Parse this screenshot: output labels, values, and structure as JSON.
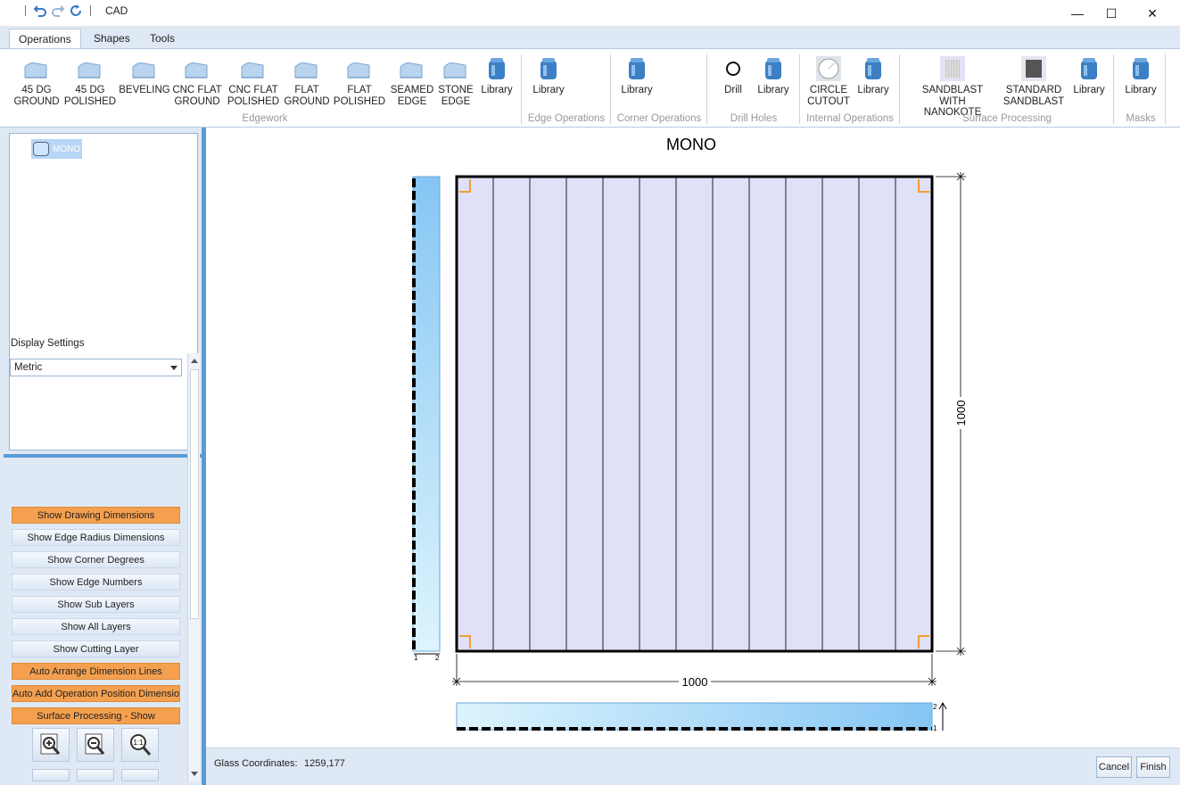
{
  "app": {
    "title": "CAD"
  },
  "window": {
    "minimize_glyph": "—",
    "maximize_glyph": "☐",
    "close_glyph": "✕"
  },
  "tabs": [
    {
      "label": "Operations",
      "active": true
    },
    {
      "label": "Shapes",
      "active": false
    },
    {
      "label": "Tools",
      "active": false
    }
  ],
  "ribbon": {
    "buttons": [
      {
        "label1": "45 DG",
        "label2": "GROUND",
        "icon": "edge-profile-icon"
      },
      {
        "label1": "45 DG",
        "label2": "POLISHED",
        "icon": "edge-profile-icon"
      },
      {
        "label1": "BEVELING",
        "label2": "",
        "icon": "edge-profile-icon"
      },
      {
        "label1": "CNC FLAT",
        "label2": "GROUND",
        "icon": "edge-profile-icon"
      },
      {
        "label1": "CNC FLAT",
        "label2": "POLISHED",
        "icon": "edge-profile-icon"
      },
      {
        "label1": "FLAT",
        "label2": "GROUND",
        "icon": "edge-profile-icon"
      },
      {
        "label1": "FLAT",
        "label2": "POLISHED",
        "icon": "edge-profile-icon"
      },
      {
        "label1": "SEAMED",
        "label2": "EDGE",
        "icon": "edge-profile-icon"
      },
      {
        "label1": "STONE",
        "label2": "EDGE",
        "icon": "edge-profile-icon"
      },
      {
        "label1": "Library",
        "label2": "",
        "icon": "library-jar-icon"
      },
      {
        "label1": "Library",
        "label2": "",
        "icon": "library-jar-icon"
      },
      {
        "label1": "Library",
        "label2": "",
        "icon": "library-jar-icon"
      },
      {
        "label1": "Drill",
        "label2": "",
        "icon": "drill-circle-icon"
      },
      {
        "label1": "Library",
        "label2": "",
        "icon": "library-jar-icon"
      },
      {
        "label1": "CIRCLE",
        "label2": "CUTOUT",
        "icon": "circle-cutout-icon"
      },
      {
        "label1": "Library",
        "label2": "",
        "icon": "library-jar-icon"
      },
      {
        "label1": "SANDBLAST WITH",
        "label2": "NANOKOTE",
        "icon": "sandblast-nanokote-icon"
      },
      {
        "label1": "STANDARD",
        "label2": "SANDBLAST",
        "icon": "standard-sandblast-icon"
      },
      {
        "label1": "Library",
        "label2": "",
        "icon": "library-jar-icon"
      },
      {
        "label1": "Library",
        "label2": "",
        "icon": "library-jar-icon"
      }
    ],
    "groups": [
      {
        "label": "Edgework"
      },
      {
        "label": "Edge Operations"
      },
      {
        "label": "Corner Operations"
      },
      {
        "label": "Drill Holes"
      },
      {
        "label": "Internal Operations"
      },
      {
        "label": "Surface Processing"
      },
      {
        "label": "Masks"
      }
    ]
  },
  "tree": {
    "items": [
      {
        "label": "MONO"
      }
    ]
  },
  "display_settings": {
    "title": "Display Settings",
    "units": "Metric",
    "buttons": [
      {
        "label": "Show Drawing Dimensions",
        "active": true
      },
      {
        "label": "Show Edge Radius Dimensions",
        "active": false
      },
      {
        "label": "Show Corner Degrees",
        "active": false
      },
      {
        "label": "Show Edge Numbers",
        "active": false
      },
      {
        "label": "Show Sub Layers",
        "active": false
      },
      {
        "label": "Show All Layers",
        "active": false
      },
      {
        "label": "Show Cutting Layer",
        "active": false
      },
      {
        "label": "Auto Arrange Dimension Lines",
        "active": true
      },
      {
        "label": "Auto Add Operation Position Dimension",
        "active": true
      },
      {
        "label": "Surface Processing - Show",
        "active": true
      }
    ],
    "zoom_buttons": [
      "zoom-in-icon",
      "zoom-out-icon",
      "zoom-actual-size-icon"
    ],
    "zoom_actual_label": "1:1"
  },
  "drawing": {
    "title": "MONO",
    "width_label": "1000",
    "height_label": "1000",
    "side_view_numbers": [
      "1",
      "2"
    ],
    "bottom_view_numbers": [
      "2",
      "1"
    ],
    "panel_fill": "#e0e0f8",
    "stripe_count": 13,
    "corner_marker_color": "#f0a030"
  },
  "status": {
    "coordinates_label": "Glass Coordinates:",
    "coordinates_value": "1259,177"
  },
  "actions": {
    "cancel": "Cancel",
    "finish": "Finish"
  },
  "colors": {
    "accent": "#5b9bd5",
    "active_setting": "#f4a04f",
    "ribbon_bg": "#dfe9f5"
  }
}
